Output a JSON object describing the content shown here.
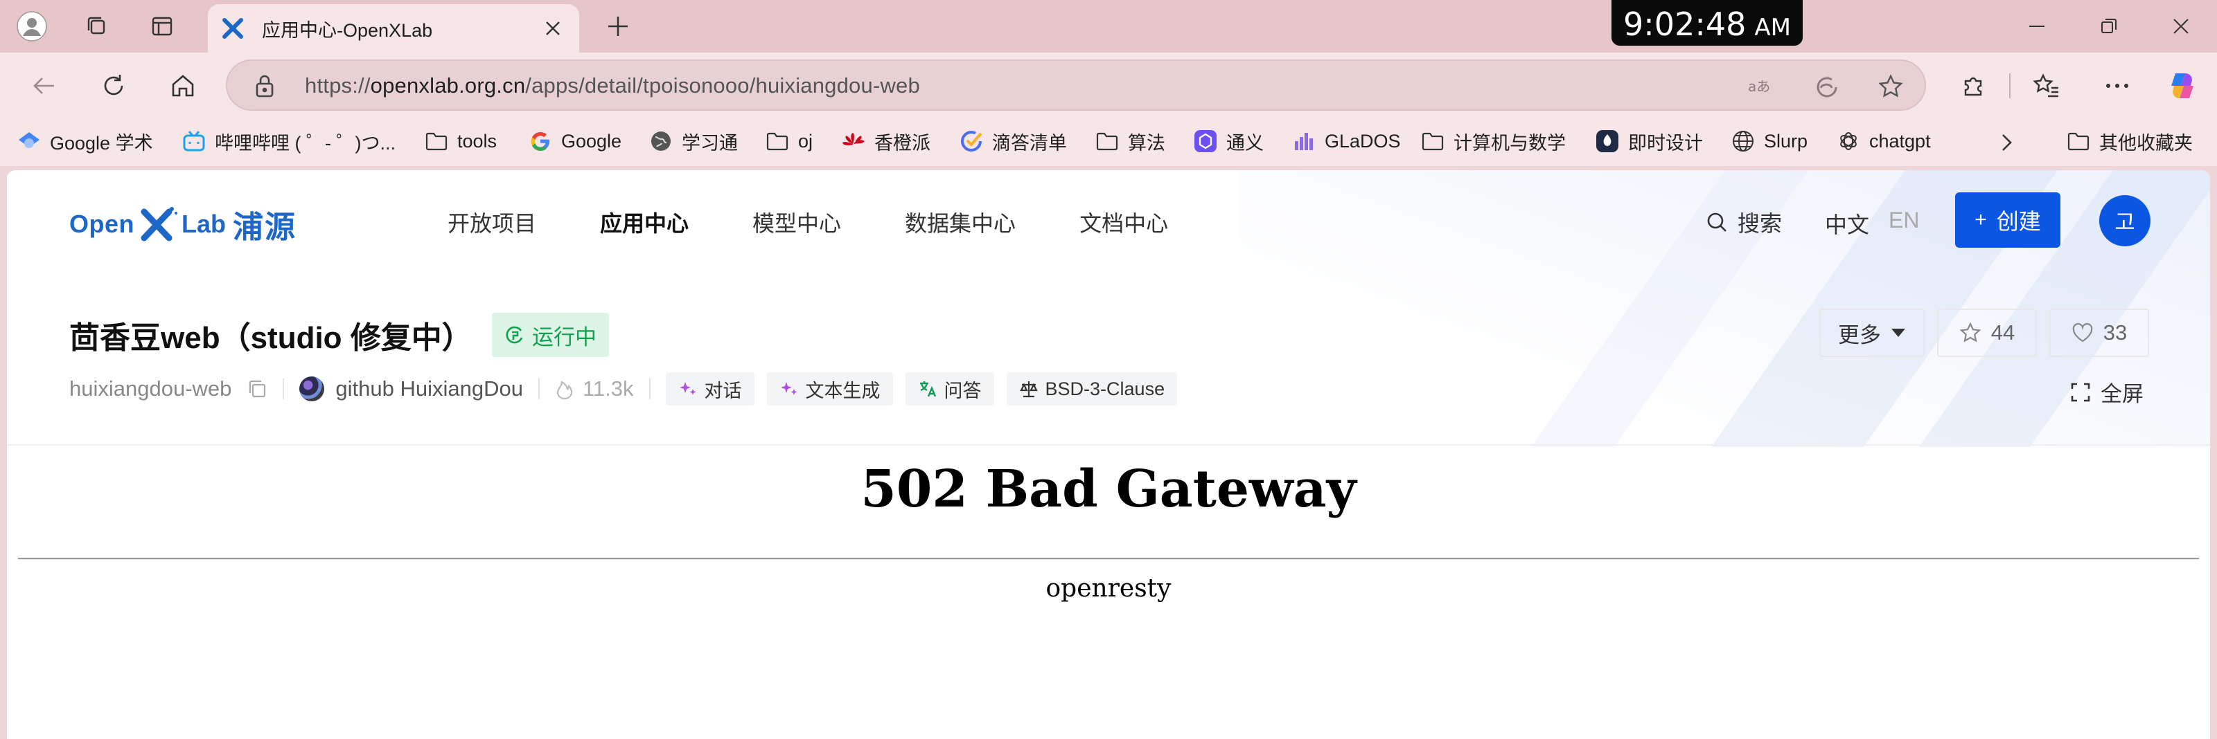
{
  "browser": {
    "tab": {
      "title": "应用中心-OpenXLab"
    },
    "clock": {
      "time": "9:02:48",
      "ampm": "AM"
    },
    "address": {
      "scheme": "https://",
      "host": "openxlab.org.cn",
      "path": "/apps/detail/tpoisonooo/huixiangdou-web"
    },
    "bookmarks": [
      {
        "label": "Google 学术",
        "icon": "google-scholar-icon"
      },
      {
        "label": "哔哩哔哩 ( ゜- ゜)つ...",
        "icon": "bilibili-icon"
      },
      {
        "label": "tools",
        "icon": "folder-icon"
      },
      {
        "label": "Google",
        "icon": "google-icon"
      },
      {
        "label": "学习通",
        "icon": "globe-icon"
      },
      {
        "label": "oj",
        "icon": "folder-icon"
      },
      {
        "label": "香橙派",
        "icon": "huawei-icon"
      },
      {
        "label": "滴答清单",
        "icon": "ticktick-icon"
      },
      {
        "label": "算法",
        "icon": "folder-icon"
      },
      {
        "label": "通义",
        "icon": "tongyi-icon"
      },
      {
        "label": "GLaDOS",
        "icon": "glados-icon"
      },
      {
        "label": "计算机与数学",
        "icon": "folder-icon"
      },
      {
        "label": "即时设计",
        "icon": "jsdesign-icon"
      },
      {
        "label": "Slurp",
        "icon": "globe-icon"
      },
      {
        "label": "chatgpt",
        "icon": "openai-icon"
      }
    ],
    "bookmarks_other": "其他收藏夹"
  },
  "site": {
    "logo": {
      "open": "Open",
      "lab": "Lab",
      "cn": "浦源"
    },
    "nav": [
      "开放项目",
      "应用中心",
      "模型中心",
      "数据集中心",
      "文档中心"
    ],
    "nav_active": "应用中心",
    "search_label": "搜索",
    "lang_zh": "中文",
    "lang_en": "EN",
    "create_label": "创建",
    "avatar_text": "고"
  },
  "app": {
    "title": "茴香豆web（studio 修复中）",
    "status": "运行中",
    "more_label": "更多",
    "stars": "44",
    "likes": "33",
    "slug": "huixiangdou-web",
    "owner": "github HuixiangDou",
    "views": "11.3k",
    "tags": [
      {
        "label": "对话",
        "icon": "sparkle-icon"
      },
      {
        "label": "文本生成",
        "icon": "sparkle-icon"
      },
      {
        "label": "问答",
        "icon": "translate-icon"
      },
      {
        "label": "BSD-3-Clause",
        "icon": "scale-icon"
      }
    ],
    "fullscreen_label": "全屏"
  },
  "error": {
    "title": "502 Bad Gateway",
    "server": "openresty"
  },
  "colors": {
    "brand": "#0b57e4",
    "logo": "#1d67c9",
    "status_green": "#12a150",
    "tab_strip": "#e7c6c9"
  }
}
